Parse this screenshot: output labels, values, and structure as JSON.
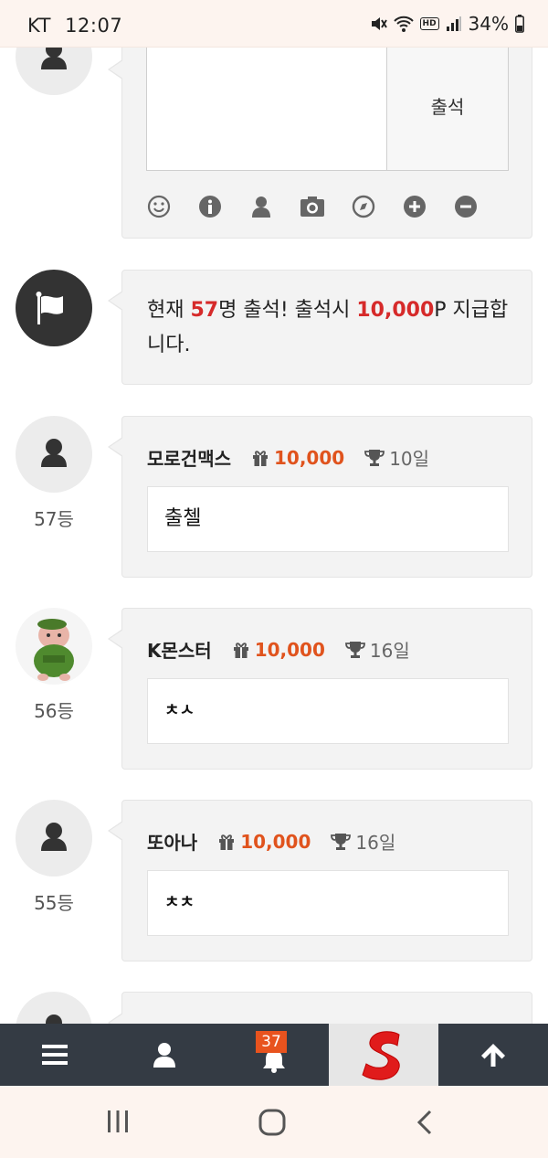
{
  "status_bar": {
    "carrier": "KT",
    "time": "12:07",
    "battery": "34%",
    "hd_label": "HD"
  },
  "comment_form": {
    "submit_label": "출석"
  },
  "notice": {
    "prefix": "현재 ",
    "count": "57",
    "mid": "명 출석! 출석시 ",
    "points": "10,000",
    "suffix": "P 지급합니다."
  },
  "posts": [
    {
      "rank": "57등",
      "name": "모로건맥스",
      "points": "10,000",
      "days": "10일",
      "message": "출첼"
    },
    {
      "rank": "56등",
      "name": "K몬스터",
      "points": "10,000",
      "days": "16일",
      "message": "ㅊㅅ"
    },
    {
      "rank": "55등",
      "name": "또아나",
      "points": "10,000",
      "days": "16일",
      "message": "ㅊㅊ"
    }
  ],
  "app_nav": {
    "notification_count": "37"
  },
  "colors": {
    "accent": "#e0531d",
    "notice_red": "#d62a2a",
    "nav_bg": "#343b44"
  }
}
